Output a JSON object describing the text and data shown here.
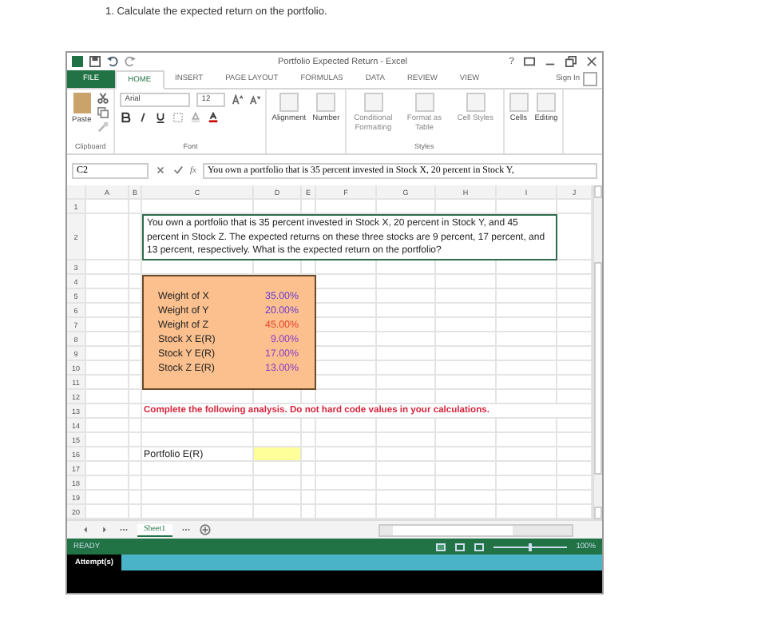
{
  "question": "1.  Calculate the expected return on the portfolio.",
  "window": {
    "title": "Portfolio Expected Return - Excel",
    "help": "?"
  },
  "ribbon_tabs": [
    {
      "label": "FILE",
      "kind": "file",
      "selected": false
    },
    {
      "label": "HOME",
      "kind": "tab",
      "selected": true
    },
    {
      "label": "INSERT",
      "kind": "tab",
      "selected": false
    },
    {
      "label": "PAGE LAYOUT",
      "kind": "tab",
      "selected": false
    },
    {
      "label": "FORMULAS",
      "kind": "tab",
      "selected": false
    },
    {
      "label": "DATA",
      "kind": "tab",
      "selected": false
    },
    {
      "label": "REVIEW",
      "kind": "tab",
      "selected": false
    },
    {
      "label": "VIEW",
      "kind": "tab",
      "selected": false
    }
  ],
  "sign_in": "Sign In",
  "ribbon": {
    "paste": "Paste",
    "font_name": "Arial",
    "font_size": "12",
    "alignment": "Alignment",
    "number": "Number",
    "conditional_formatting": "Conditional Formatting",
    "format_as_table": "Format as Table",
    "cell_styles": "Cell Styles",
    "cells": "Cells",
    "editing": "Editing",
    "group_labels": [
      "Clipboard",
      "Font",
      "Styles"
    ]
  },
  "zoom_slider": {
    "level": 0.5
  },
  "formula_bar": {
    "name_box": "C2",
    "fx": "fx",
    "formula": "You own a portfolio that is 35 percent invested in Stock X, 20 percent in Stock Y,"
  },
  "columns": [
    "A",
    "B",
    "C",
    "D",
    "E",
    "F",
    "G",
    "H",
    "I",
    "J"
  ],
  "rows": [
    {
      "number": "1",
      "kind": "blank"
    },
    {
      "number": "2",
      "kind": "question",
      "text": "You own a portfolio that is 35 percent invested in Stock X, 20 percent in Stock Y, and 45 percent in Stock Z. The expected returns on these three stocks are 9 percent, 17 percent, and 13 percent, respectively. What is the expected return on the portfolio?"
    },
    {
      "number": "3",
      "kind": "blank"
    },
    {
      "number": "4",
      "kind": "input"
    },
    {
      "number": "5",
      "kind": "input",
      "label": "Weight of X",
      "value": "35.00%",
      "color": "#6a3cd0"
    },
    {
      "number": "6",
      "kind": "input",
      "label": "Weight of Y",
      "value": "20.00%",
      "color": "#6a3cd0"
    },
    {
      "number": "7",
      "kind": "input",
      "label": "Weight of Z",
      "value": "45.00%",
      "color": "#e8402a"
    },
    {
      "number": "8",
      "kind": "input",
      "label": "Stock X E(R)",
      "value": "9.00%",
      "color": "#8a3cc8"
    },
    {
      "number": "9",
      "kind": "input",
      "label": "Stock Y E(R)",
      "value": "17.00%",
      "color": "#8a3cc8"
    },
    {
      "number": "10",
      "kind": "input",
      "label": "Stock Z E(R)",
      "value": "13.00%",
      "color": "#8a3cc8"
    },
    {
      "number": "11",
      "kind": "input"
    },
    {
      "number": "12",
      "kind": "blank"
    },
    {
      "number": "13",
      "kind": "instruction",
      "text": "Complete the following analysis. Do not hard code values in your calculations."
    },
    {
      "number": "14",
      "kind": "blank"
    },
    {
      "number": "15",
      "kind": "blank"
    },
    {
      "number": "16",
      "kind": "answer",
      "label": "Portfolio E(R)"
    },
    {
      "number": "17",
      "kind": "blank"
    },
    {
      "number": "18",
      "kind": "blank"
    },
    {
      "number": "19",
      "kind": "blank"
    },
    {
      "number": "20",
      "kind": "blank"
    }
  ],
  "sheet_tabs": [
    {
      "label": "Sheet1",
      "selected": true
    }
  ],
  "status": "READY",
  "zoom": "100%",
  "attempts": "Attempt(s)"
}
